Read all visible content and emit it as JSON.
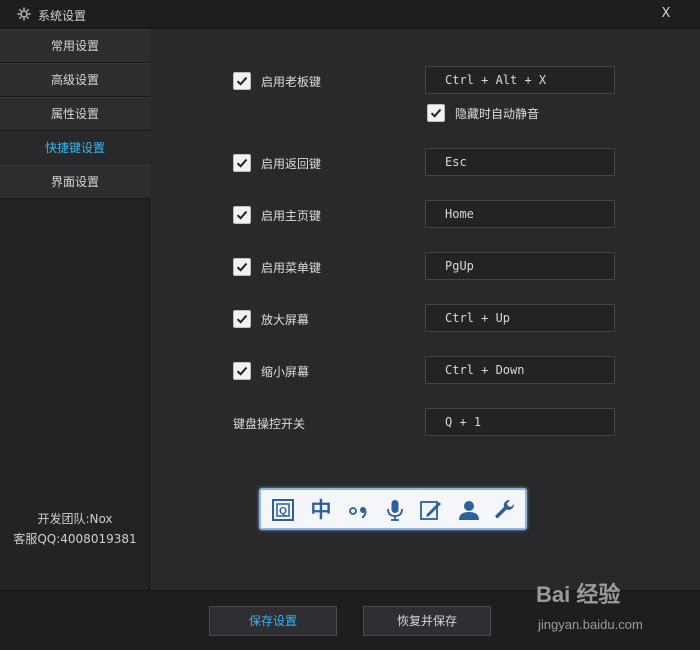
{
  "window": {
    "title": "系统设置",
    "close_label": "X"
  },
  "sidebar": {
    "items": [
      {
        "label": "常用设置",
        "active": false
      },
      {
        "label": "高级设置",
        "active": false
      },
      {
        "label": "属性设置",
        "active": false
      },
      {
        "label": "快捷键设置",
        "active": true
      },
      {
        "label": "界面设置",
        "active": false
      }
    ],
    "team": "开发团队:Nox",
    "qq": "客服QQ:4008019381"
  },
  "hotkeys": [
    {
      "label": "启用老板键",
      "checked": true,
      "value": "Ctrl + Alt + X"
    },
    {
      "label": "启用返回键",
      "checked": true,
      "value": "Esc"
    },
    {
      "label": "启用主页键",
      "checked": true,
      "value": "Home"
    },
    {
      "label": "启用菜单键",
      "checked": true,
      "value": "PgUp"
    },
    {
      "label": "放大屏幕",
      "checked": true,
      "value": "Ctrl + Up"
    },
    {
      "label": "缩小屏幕",
      "checked": true,
      "value": "Ctrl + Down"
    },
    {
      "label": "键盘操控开关",
      "checked": null,
      "value": "Q + 1"
    }
  ],
  "boss_key_option": {
    "label": "隐藏时自动静音",
    "checked": true
  },
  "ime_toolbar": {
    "icons": [
      "ime-logo-icon",
      "chinese-mode-icon",
      "punctuation-icon",
      "microphone-icon",
      "handwriting-icon",
      "user-icon",
      "wrench-icon"
    ],
    "chinese_char": "中"
  },
  "footer": {
    "save_label": "保存设置",
    "restore_label": "恢复并保存"
  },
  "watermark": {
    "brand": "Bai 经验",
    "url": "jingyan.baidu.com"
  },
  "colors": {
    "accent": "#33b4f0",
    "background": "#29292b",
    "sidebar": "#232325"
  }
}
